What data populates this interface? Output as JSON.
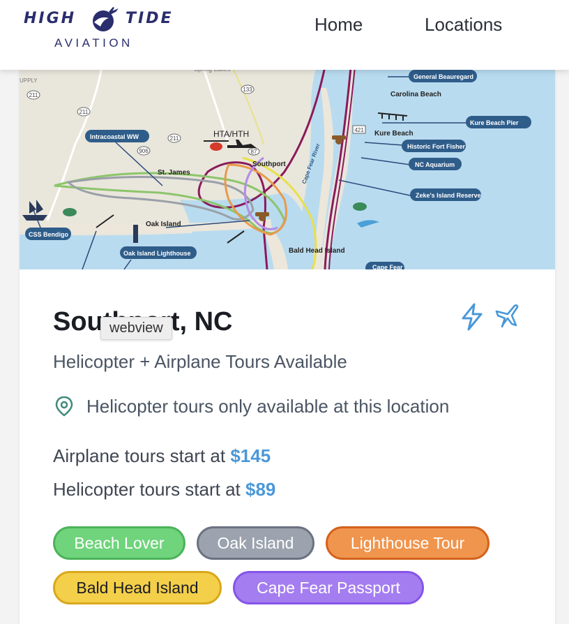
{
  "brand": {
    "word1": "HIGH",
    "word2": "TIDE",
    "word3": "AVIATION"
  },
  "nav": {
    "home": "Home",
    "locations": "Locations"
  },
  "map": {
    "labels": {
      "general_beauregard": "General Beauregard",
      "carolina_beach": "Carolina Beach",
      "kure_beach_pier": "Kure Beach Pier",
      "kure_beach": "Kure Beach",
      "historic_fort_fisher": "Historic Fort Fisher",
      "nc_aquarium": "NC Aquarium",
      "zekes_island": "Zeke's Island Reserve",
      "intracoastal_ww": "Intracoastal WW",
      "hta_hth": "HTA/HTH",
      "southport": "Southport",
      "st_james": "St. James",
      "oak_island": "Oak Island",
      "css_bendigo": "CSS Bendigo",
      "oak_island_lighthouse": "Oak Island Lighthouse",
      "bald_head_island": "Bald Head Island",
      "cape_fear": "Cape Fear",
      "cape_fear_river": "Cape Fear River",
      "spring_lakes": "Spring Lakes",
      "upply": "UPPLY",
      "route_133": "133",
      "route_211a": "211",
      "route_211b": "211",
      "route_211c": "211",
      "route_906": "906",
      "route_87": "87",
      "route_421": "421"
    }
  },
  "location": {
    "title": "Southport, NC",
    "tooltip": "webview",
    "subtitle": "Helicopter + Airplane Tours Available",
    "note": "Helicopter tours only available at this location",
    "airplane_prefix": "Airplane tours start at ",
    "airplane_price": "$145",
    "helicopter_prefix": "Helicopter tours start at ",
    "helicopter_price": "$89"
  },
  "tags": [
    {
      "label": "Beach Lover",
      "bg": "#6fd47c",
      "border": "#4cb35a"
    },
    {
      "label": "Oak Island",
      "bg": "#9ca3af",
      "border": "#6b7280"
    },
    {
      "label": "Lighthouse Tour",
      "bg": "#f0954d",
      "border": "#d4621c"
    },
    {
      "label": "Bald Head Island",
      "bg": "#f4cf4a",
      "border": "#d9a81c",
      "text": "#1a1d23"
    },
    {
      "label": "Cape Fear Passport",
      "bg": "#a47df0",
      "border": "#8655e8"
    }
  ],
  "icons": {
    "bolt": "bolt-icon",
    "plane": "airplane-icon",
    "location": "map-pin-icon"
  },
  "colors": {
    "accent": "#4a98d8",
    "brand": "#2a2e6e"
  }
}
